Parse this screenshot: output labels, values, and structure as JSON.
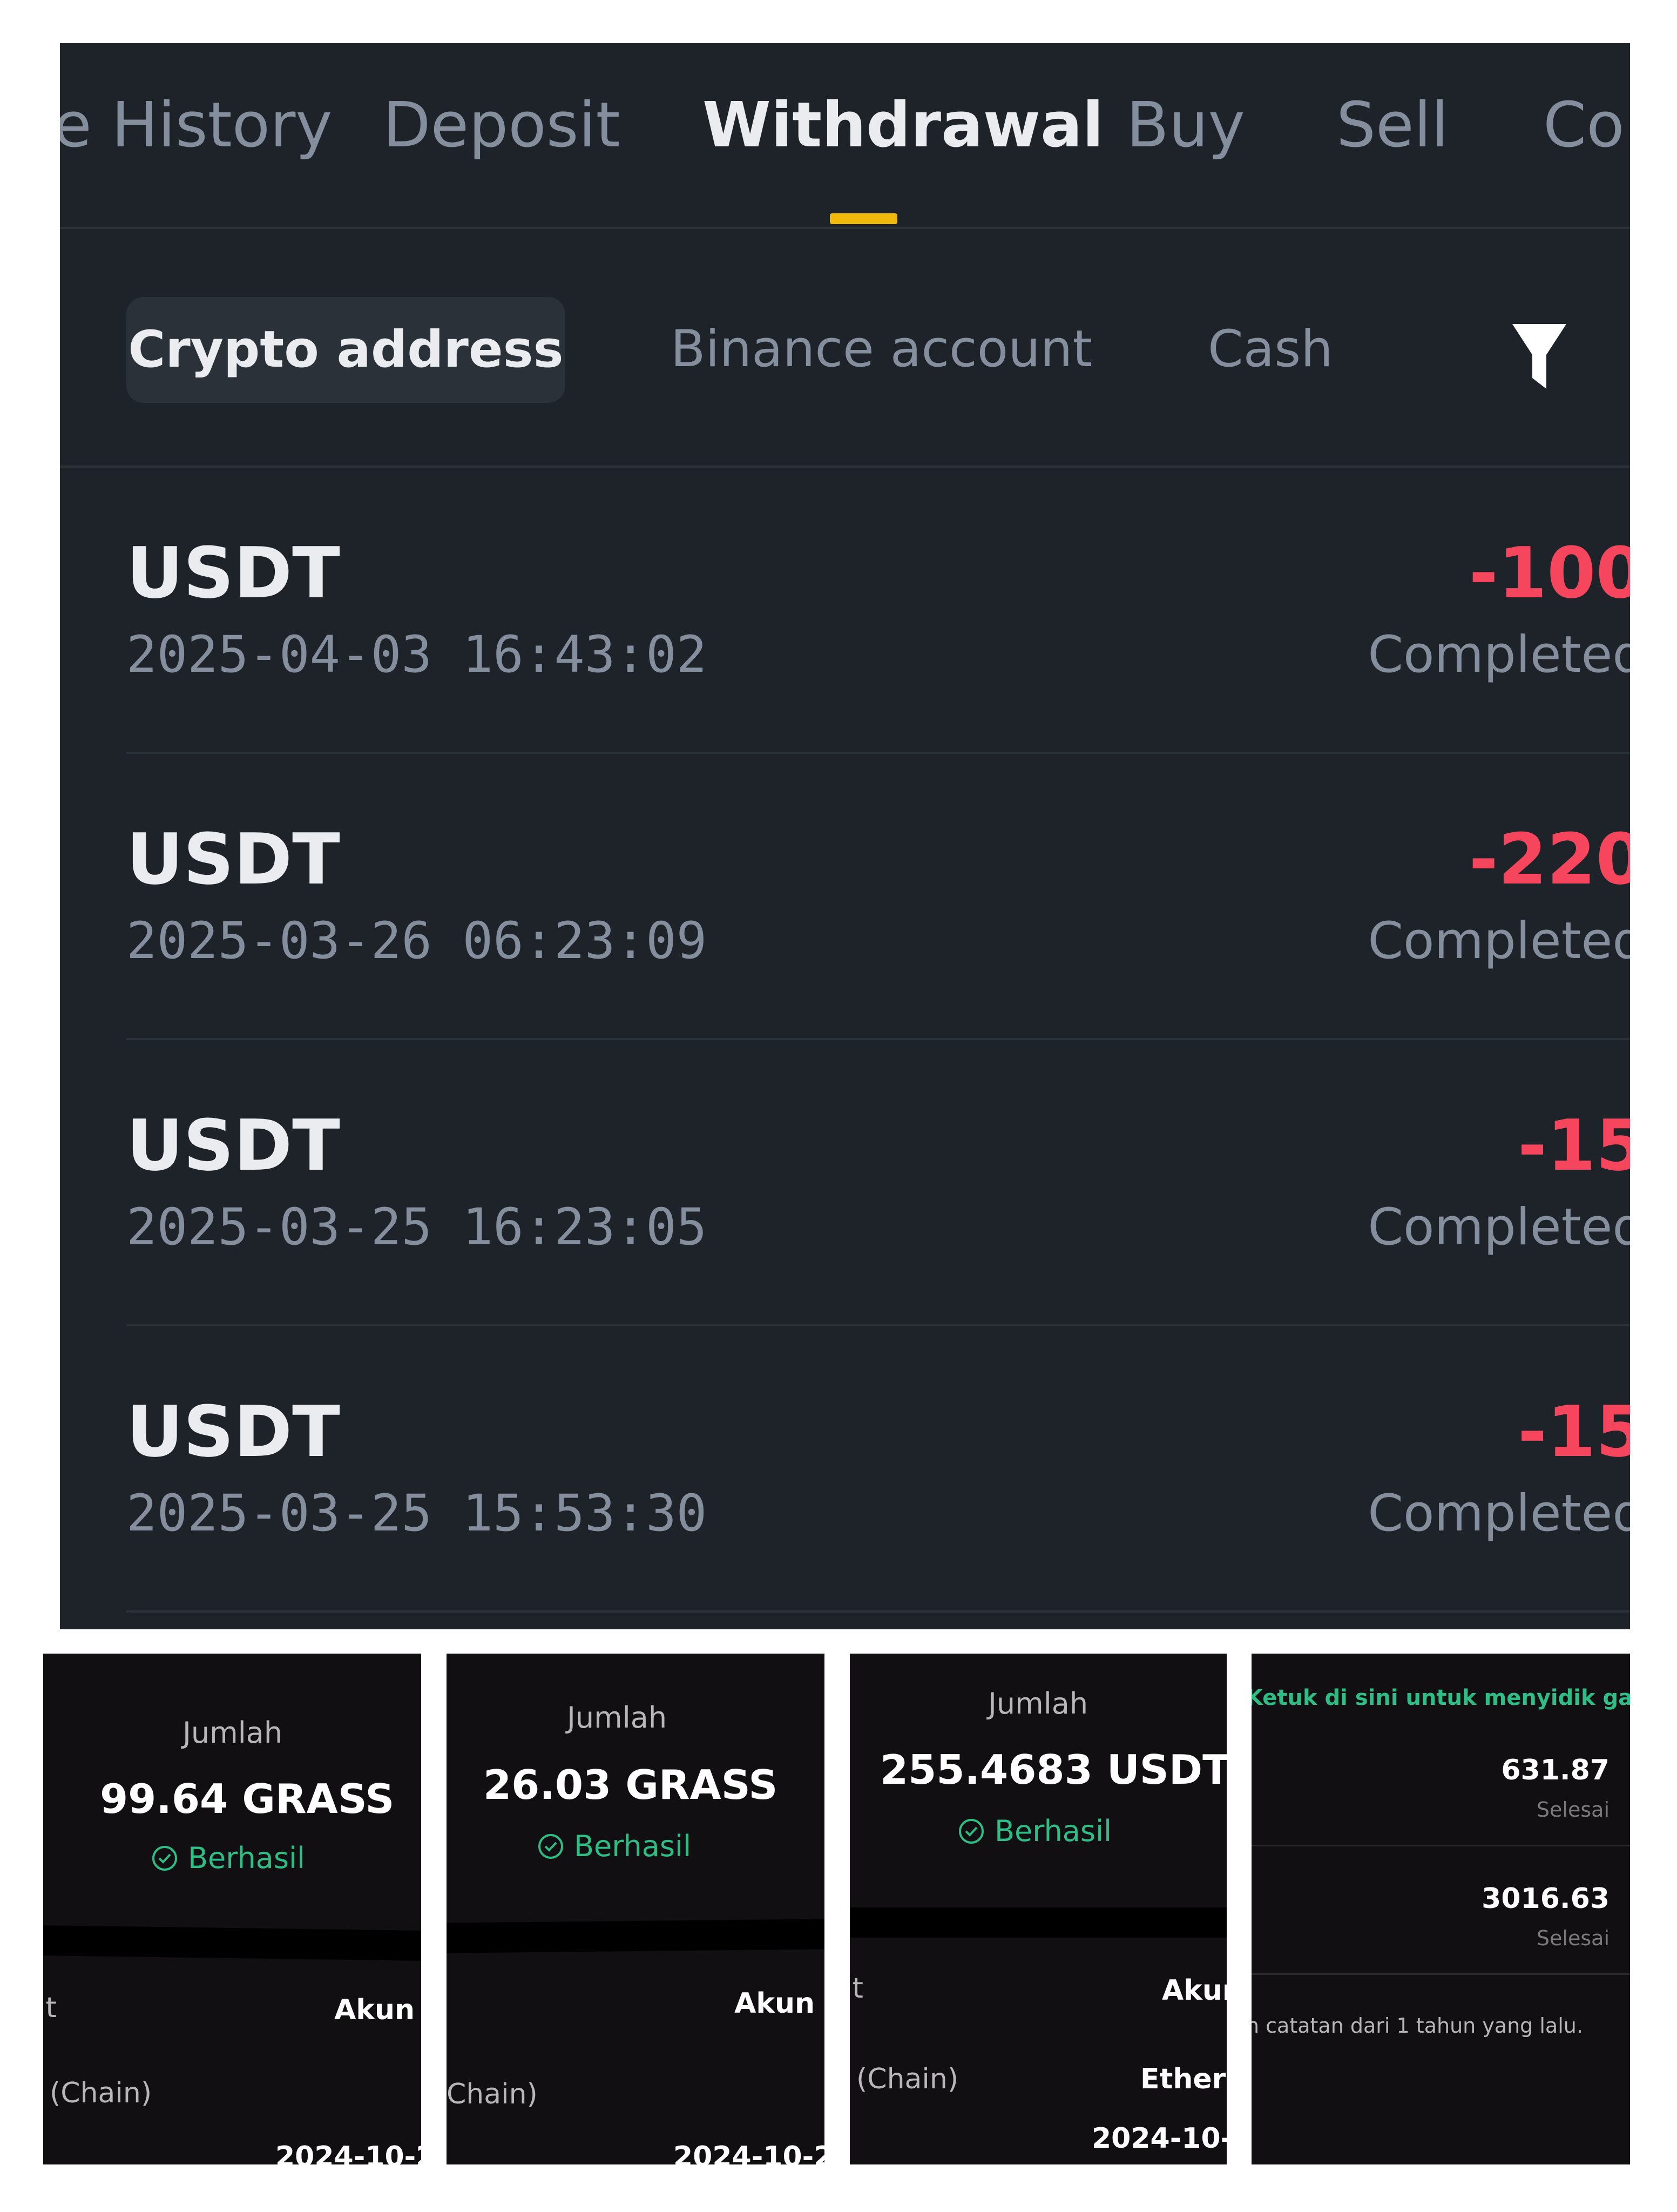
{
  "tabs": {
    "history": "History",
    "history_prefix": "e",
    "deposit": "Deposit",
    "withdrawal": "Withdrawal",
    "buy": "Buy",
    "sell": "Sell",
    "convert_partial": "Co"
  },
  "subtabs": {
    "crypto_address": "Crypto address",
    "binance_account": "Binance account",
    "cash": "Cash"
  },
  "withdrawals": [
    {
      "coin": "USDT",
      "time": "2025-04-03 16:43:02",
      "amount": "-100",
      "status": "Completed"
    },
    {
      "coin": "USDT",
      "time": "2025-03-26 06:23:09",
      "amount": "-220",
      "status": "Completed"
    },
    {
      "coin": "USDT",
      "time": "2025-03-25 16:23:05",
      "amount": "-15",
      "status": "Completed"
    },
    {
      "coin": "USDT",
      "time": "2025-03-25 15:53:30",
      "amount": "-15",
      "status": "Completed"
    }
  ],
  "colors": {
    "accent": "#f0b90b",
    "negative": "#f6465d",
    "success": "#2ebd85",
    "panel_bg": "#1e2329"
  },
  "crops": [
    {
      "label": "Jumlah",
      "amount": "99.64 GRASS",
      "status": "Berhasil",
      "frag": "it",
      "akun": "Akun",
      "chain": "(Chain)",
      "date": "2024-10-2"
    },
    {
      "label": "Jumlah",
      "amount": "26.03 GRASS",
      "status": "Berhasil",
      "akun": "Akun",
      "chain": "Chain)",
      "date": "2024-10-2"
    },
    {
      "label": "Jumlah",
      "amount": "255.4683 USDT",
      "status": "Berhasil",
      "frag": "it",
      "akun": "Akun",
      "chain": "(Chain)",
      "network": "Ethere",
      "date": "2024-10-"
    }
  ],
  "crop4": {
    "link": "Ketuk di sini untuk menyidik ganggua",
    "items": [
      {
        "value": "631.87",
        "status": "Selesai"
      },
      {
        "value": "3016.63",
        "status": "Selesai"
      }
    ],
    "note": "n catatan dari 1 tahun yang lalu."
  }
}
